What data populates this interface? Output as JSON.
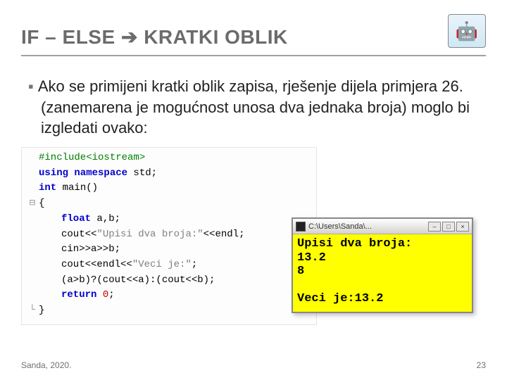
{
  "title": {
    "left": "IF – ELSE",
    "arrow": "➔",
    "right": "KRATKI OBLIK"
  },
  "mascot_emoji": "🤖",
  "paragraph": "Ako se primijeni kratki oblik zapisa, rješenje dijela primjera 26. (zanemarena je mogućnost unosa dva jednaka broja) moglo bi izgledati ovako:",
  "code": {
    "l1_pre": "#include<iostream>",
    "l2_a": "using namespace",
    "l2_b": " std;",
    "l3_a": "int",
    "l3_b": " main()",
    "l4": "{",
    "l5_a": "float",
    "l5_b": " a,b;",
    "l6_a": "cout<<",
    "l6_str": "\"Upisi dva broja:\"",
    "l6_b": "<<endl;",
    "l7": "cin>>a>>b;",
    "l8_a": "cout<<endl<<",
    "l8_str": "\"Veci je:\"",
    "l8_b": ";",
    "l9": "(a>b)?(cout<<a):(cout<<b);",
    "l10_a": "return",
    "l10_b": " 0",
    "l10_c": ";",
    "l11": "}"
  },
  "console": {
    "title": "C:\\Users\\Sanda\\...",
    "min": "–",
    "max": "□",
    "close": "×",
    "output": "Upisi dva broja:\n13.2\n8\n\nVeci je:13.2"
  },
  "footer": {
    "left": "Sanda, 2020.",
    "right": "23"
  }
}
